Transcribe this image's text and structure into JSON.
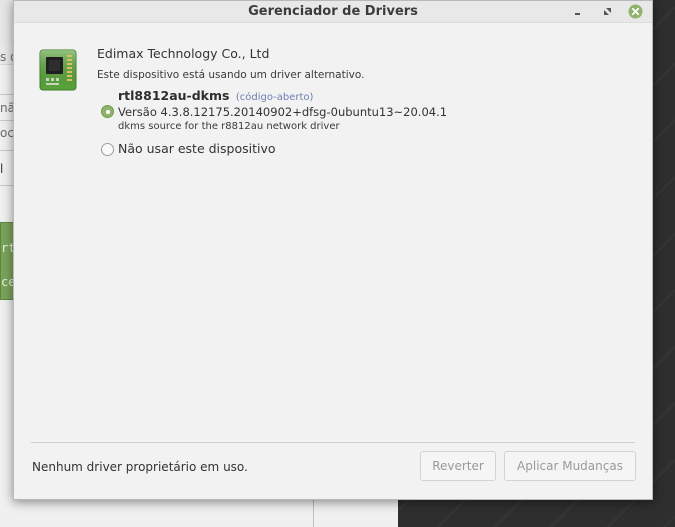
{
  "window": {
    "title": "Gerenciador de Drivers"
  },
  "background_window": {
    "fragments": [
      "s d",
      "nã",
      "oc",
      "l",
      "rt",
      "ce"
    ]
  },
  "device": {
    "icon": "network-card-icon",
    "vendor": "Edimax Technology Co., Ltd",
    "status": "Este dispositivo está usando um driver alternativo."
  },
  "drivers": [
    {
      "name": "rtl8812au-dkms",
      "tag": "(código-aberto)",
      "version": "Versão 4.3.8.12175.20140902+dfsg-0ubuntu13~20.04.1",
      "description": "dkms source for the r8812au network driver",
      "selected": true
    }
  ],
  "no_use_option": {
    "label": "Não usar este dispositivo",
    "selected": false
  },
  "footer": {
    "status": "Nenhum driver proprietário em uso.",
    "revert_label": "Reverter",
    "apply_label": "Aplicar Mudanças"
  },
  "colors": {
    "radio_selected": "#8fb36a",
    "tag_color": "#6c7fb4",
    "close_button": "#8fb36a"
  }
}
